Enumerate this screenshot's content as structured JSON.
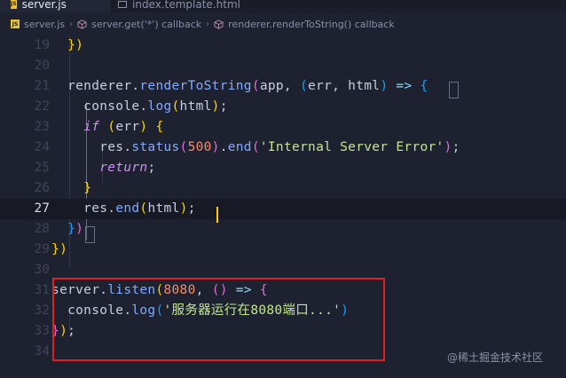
{
  "tabs": [
    {
      "badge": "JS",
      "name": "server.js",
      "modified": true
    },
    {
      "name": "index.template.html"
    }
  ],
  "breadcrumb": {
    "badge": "JS",
    "file": "server.js",
    "items": [
      "server.get('*') callback",
      "renderer.renderToString() callback"
    ]
  },
  "editor": {
    "current_line": 27,
    "lines": [
      {
        "n": "19",
        "tokens": [
          [
            "    ",
            "plain"
          ],
          [
            "})",
            "b1"
          ]
        ]
      },
      {
        "n": "20",
        "tokens": []
      },
      {
        "n": "21",
        "tokens": [
          [
            "    renderer.",
            "plain"
          ],
          [
            "renderToString",
            "fn"
          ],
          [
            "(",
            "b2"
          ],
          [
            "app, ",
            "plain"
          ],
          [
            "(",
            "b3"
          ],
          [
            "err, html",
            "plain"
          ],
          [
            ")",
            "b3"
          ],
          [
            " ",
            "plain"
          ],
          [
            "=>",
            "op"
          ],
          [
            " ",
            "plain"
          ],
          [
            "{",
            "b3"
          ]
        ]
      },
      {
        "n": "22",
        "tokens": [
          [
            "      console.",
            "plain"
          ],
          [
            "log",
            "fn"
          ],
          [
            "(",
            "b1"
          ],
          [
            "html",
            "plain"
          ],
          [
            ")",
            "b1"
          ],
          [
            ";",
            "plain"
          ]
        ]
      },
      {
        "n": "23",
        "tokens": [
          [
            "      ",
            "plain"
          ],
          [
            "if",
            "kw"
          ],
          [
            " ",
            "plain"
          ],
          [
            "(",
            "b1"
          ],
          [
            "err",
            "plain"
          ],
          [
            ")",
            "b1"
          ],
          [
            " ",
            "plain"
          ],
          [
            "{",
            "b1"
          ]
        ]
      },
      {
        "n": "24",
        "tokens": [
          [
            "        res.",
            "plain"
          ],
          [
            "status",
            "fn"
          ],
          [
            "(",
            "b2"
          ],
          [
            "500",
            "num"
          ],
          [
            ")",
            "b2"
          ],
          [
            ".",
            "plain"
          ],
          [
            "end",
            "fn"
          ],
          [
            "(",
            "b2"
          ],
          [
            "'Internal Server Error'",
            "str"
          ],
          [
            ")",
            "b2"
          ],
          [
            ";",
            "plain"
          ]
        ]
      },
      {
        "n": "25",
        "tokens": [
          [
            "        ",
            "plain"
          ],
          [
            "return",
            "kw"
          ],
          [
            ";",
            "plain"
          ]
        ]
      },
      {
        "n": "26",
        "tokens": [
          [
            "      ",
            "plain"
          ],
          [
            "}",
            "b1"
          ]
        ]
      },
      {
        "n": "27",
        "tokens": [
          [
            "      res.",
            "plain"
          ],
          [
            "end",
            "fn"
          ],
          [
            "(",
            "b1"
          ],
          [
            "html",
            "plain"
          ],
          [
            ")",
            "b1"
          ],
          [
            ";",
            "plain"
          ]
        ]
      },
      {
        "n": "28",
        "tokens": [
          [
            "    ",
            "plain"
          ],
          [
            "}",
            "b3"
          ],
          [
            ")",
            "b2"
          ]
        ]
      },
      {
        "n": "29",
        "tokens": [
          [
            "  ",
            "plain"
          ],
          [
            "})",
            "b1"
          ]
        ]
      },
      {
        "n": "30",
        "tokens": []
      },
      {
        "n": "31",
        "tokens": [
          [
            "  server.",
            "plain"
          ],
          [
            "listen",
            "fn"
          ],
          [
            "(",
            "b1"
          ],
          [
            "8080",
            "num"
          ],
          [
            ", ",
            "plain"
          ],
          [
            "(",
            "b2"
          ],
          [
            ")",
            "b2"
          ],
          [
            " ",
            "plain"
          ],
          [
            "=>",
            "op"
          ],
          [
            " ",
            "plain"
          ],
          [
            "{",
            "b2"
          ]
        ]
      },
      {
        "n": "32",
        "tokens": [
          [
            "    console.",
            "plain"
          ],
          [
            "log",
            "fn"
          ],
          [
            "(",
            "b3"
          ],
          [
            "'服务器运行在8080端口...'",
            "str"
          ],
          [
            ")",
            "b3"
          ]
        ]
      },
      {
        "n": "33",
        "tokens": [
          [
            "  ",
            "plain"
          ],
          [
            "}",
            "b2"
          ],
          [
            ")",
            "b1"
          ],
          [
            ";",
            "plain"
          ]
        ]
      },
      {
        "n": "34",
        "tokens": []
      }
    ]
  },
  "watermark": "@稀土掘金技术社区",
  "colors": {
    "background": "#1e2130",
    "highlight_box": "#e02020",
    "cursor": "#ffcc00"
  }
}
